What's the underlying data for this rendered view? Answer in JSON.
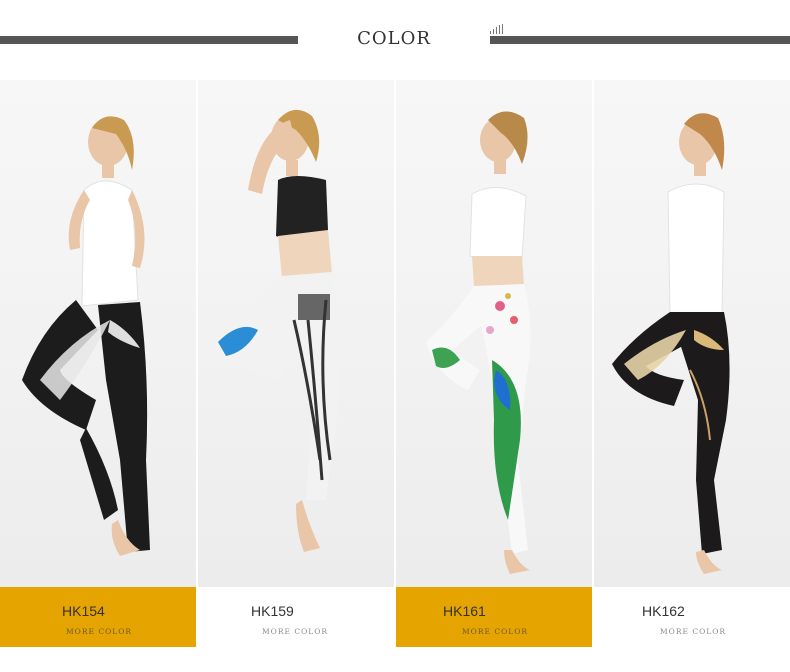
{
  "section": {
    "heading": "COLOR"
  },
  "colors": {
    "gold": "#e6a400",
    "bar": "#555555",
    "label_text": "#333333",
    "more_text": "#8a8a8a"
  },
  "products": [
    {
      "code": "HK154",
      "more": "MORE COLOR",
      "label_bg": "gold",
      "pattern": "black leggings with white crane print"
    },
    {
      "code": "HK159",
      "more": "MORE COLOR",
      "label_bg": "white",
      "pattern": "black and white feather print with blue accent"
    },
    {
      "code": "HK161",
      "more": "MORE COLOR",
      "label_bg": "gold",
      "pattern": "white leggings with peacock and floral print"
    },
    {
      "code": "HK162",
      "more": "MORE COLOR",
      "label_bg": "white",
      "pattern": "black leggings with gold crane print"
    }
  ]
}
